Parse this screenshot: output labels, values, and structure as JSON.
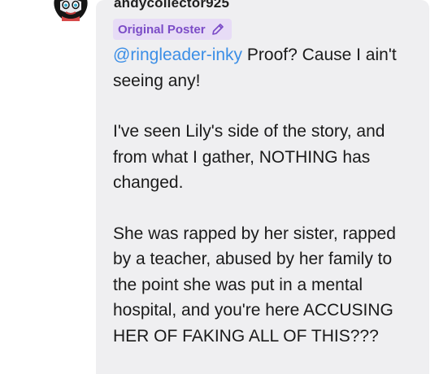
{
  "post": {
    "username": "andycollector925",
    "badge_label": "Original Poster",
    "mention": "@ringleader-inky",
    "paragraph1_rest": " Proof? Cause I ain't seeing any!",
    "paragraph2": "I've seen Lily's side of the story, and from what I gather, NOTHING has changed.",
    "paragraph3": "She was rapped by her sister, rapped by a teacher, abused by her family to the point she was put in a mental hospital, and you're here ACCUSING HER OF FAKING ALL OF THIS???"
  },
  "icons": {
    "badge_icon": "pencil-icon"
  },
  "colors": {
    "bubble_bg": "#efeff1",
    "badge_bg": "#e7dcf6",
    "badge_text": "#7b4cc7",
    "mention": "#3b8ee6"
  }
}
